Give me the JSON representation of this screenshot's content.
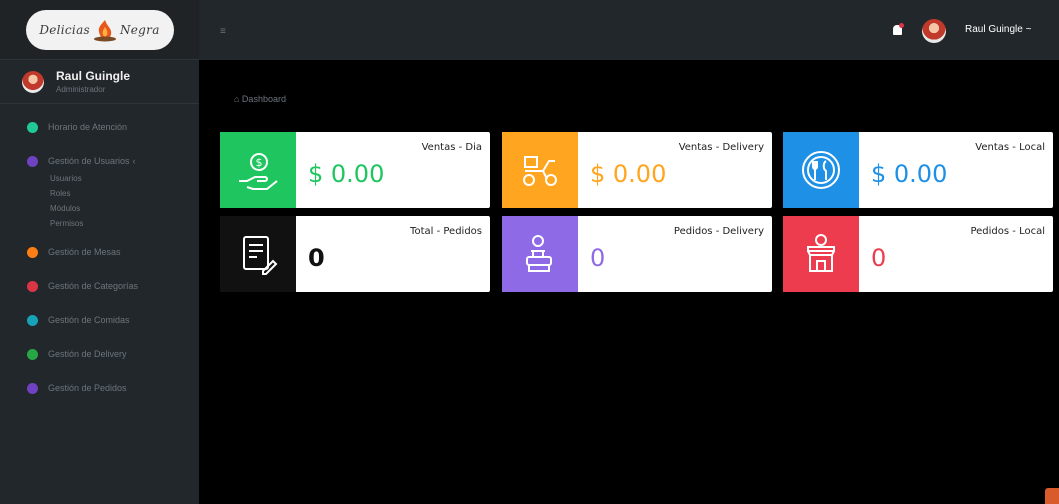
{
  "brand": {
    "logo_left": "Delicias",
    "logo_right": "Negra"
  },
  "user": {
    "name": "Raul Guingle",
    "role": "Administrador",
    "top_name": "Raul Guingle ~"
  },
  "sidebar": {
    "items": [
      {
        "label": "Horario de Atención",
        "color": "#20c997"
      },
      {
        "label": "Gestión de Usuarios",
        "color": "#6f42c1",
        "caret": "‹",
        "children": [
          "Usuarios",
          "Roles",
          "Módulos",
          "Permisos"
        ]
      },
      {
        "label": "Gestión de Mesas",
        "color": "#fd7e14"
      },
      {
        "label": "Gestión de Categorías",
        "color": "#dc3545"
      },
      {
        "label": "Gestión de Comidas",
        "color": "#17a2b8"
      },
      {
        "label": "Gestión de Delivery",
        "color": "#28a745"
      },
      {
        "label": "Gestión de Pedidos",
        "color": "#6f42c1"
      }
    ]
  },
  "topbar": {
    "hamburger": "≡"
  },
  "breadcrumb": "⌂ Dashboard",
  "cards": [
    {
      "title": "Ventas - Dia",
      "value": "$ 0.00",
      "icon": "money-hand-icon",
      "accent": "#1fc55e",
      "value_color": "#1fc55e"
    },
    {
      "title": "Ventas - Delivery",
      "value": "$ 0.00",
      "icon": "scooter-icon",
      "accent": "#ffa51f",
      "value_color": "#ffa51f"
    },
    {
      "title": "Ventas - Local",
      "value": "$ 0.00",
      "icon": "restaurant-icon",
      "accent": "#1e90e6",
      "value_color": "#1e90e6"
    },
    {
      "title": "Total - Pedidos",
      "value": "0",
      "icon": "order-list-icon",
      "accent": "#111111",
      "value_color": "#111111"
    },
    {
      "title": "Pedidos - Delivery",
      "value": "0",
      "icon": "delivery-person-icon",
      "accent": "#8e6ae6",
      "value_color": "#8e6ae6"
    },
    {
      "title": "Pedidos - Local",
      "value": "0",
      "icon": "store-icon",
      "accent": "#ee3c4f",
      "value_color": "#ee3c4f"
    }
  ]
}
